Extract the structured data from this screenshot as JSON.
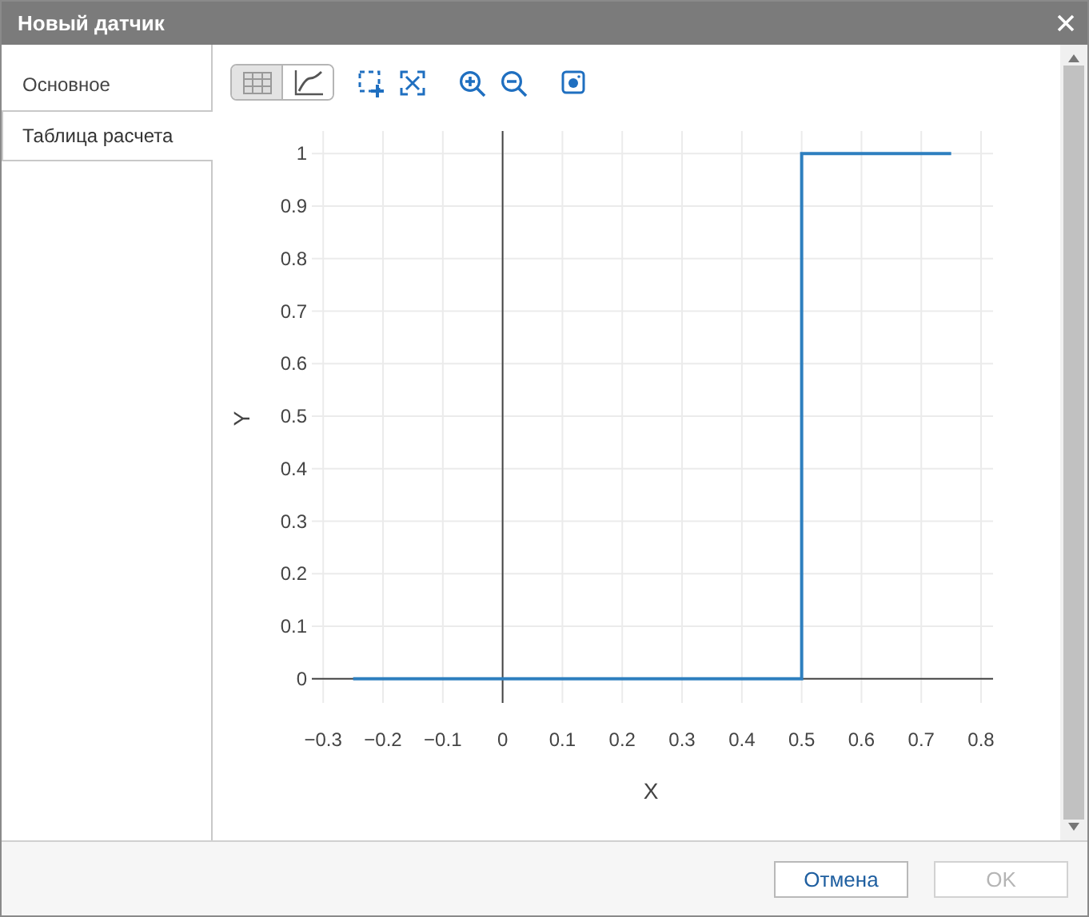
{
  "window": {
    "title": "Новый датчик"
  },
  "tabs": [
    {
      "label": "Основное",
      "selected": false
    },
    {
      "label": "Таблица расчета",
      "selected": true
    }
  ],
  "view_toggle": [
    {
      "kind": "table",
      "selected": true
    },
    {
      "kind": "chart",
      "selected": false
    }
  ],
  "chart": {
    "chart_data": {
      "type": "line",
      "xlabel": "X",
      "ylabel": "Y",
      "x": [
        -0.25,
        0.5,
        0.5,
        0.75
      ],
      "series": [
        {
          "color": "#2e7fbf",
          "values": [
            0,
            0,
            1,
            1
          ]
        }
      ],
      "grid": true,
      "xlim": [
        -0.319,
        0.82
      ],
      "ylim": [
        -0.046,
        1.043
      ],
      "xticks": [
        {
          "value": -0.3,
          "label": "−0.3"
        },
        {
          "value": -0.2,
          "label": "−0.2"
        },
        {
          "value": -0.1,
          "label": "−0.1"
        },
        0,
        0.1,
        0.2,
        0.3,
        0.4,
        0.5,
        0.6,
        0.7,
        0.8
      ],
      "yticks": [
        0,
        0.1,
        0.2,
        0.3,
        0.4,
        0.5,
        0.6,
        0.7,
        0.8,
        0.9,
        1
      ]
    }
  },
  "buttons": [
    {
      "label": "Отмена",
      "disabled": false
    },
    {
      "label": "OK",
      "disabled": true
    }
  ]
}
